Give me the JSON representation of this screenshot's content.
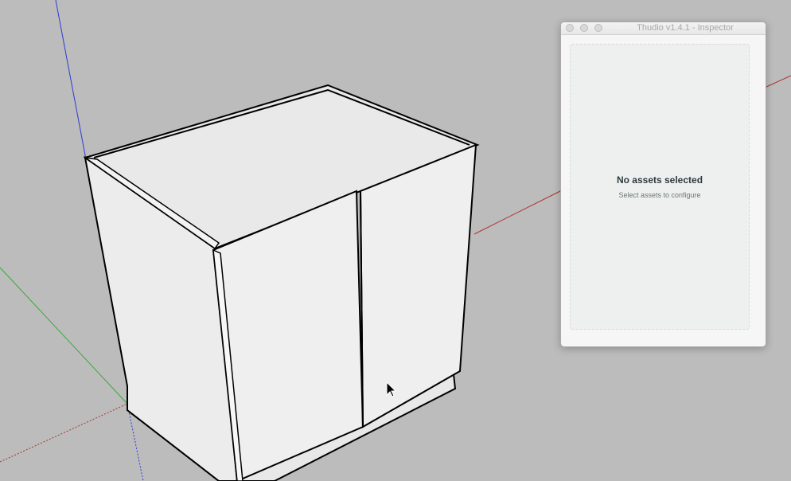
{
  "inspector": {
    "title": "Thudio v1.4.1 - Inspector",
    "empty_state": {
      "title": "No assets selected",
      "subtitle": "Select assets to configure"
    }
  },
  "colors": {
    "viewport_background": "#bcbcbc",
    "axis_blue": "#2b3bd4",
    "axis_red": "#b03030",
    "axis_green": "#3aa83a",
    "cabinet_face": "#f1f1f1",
    "cabinet_edge": "#000000"
  },
  "cursor": {
    "icon": "arrow-cursor-icon"
  }
}
